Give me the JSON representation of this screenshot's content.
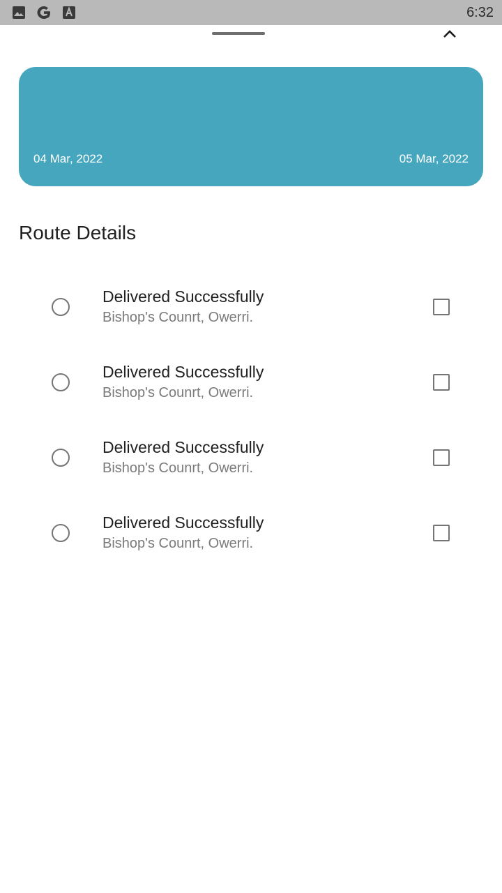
{
  "status_bar": {
    "time": "6:32",
    "icons": [
      "gallery-icon",
      "google-icon",
      "font-icon"
    ]
  },
  "sheet": {
    "handle": "drag-handle",
    "collapse_icon": "chevron-up-icon"
  },
  "trip_card": {
    "color": "#45a6be",
    "start_date": "04 Mar, 2022",
    "end_date": "05 Mar, 2022"
  },
  "route_details": {
    "title": "Route Details",
    "items": [
      {
        "status": "Delivered Successfully",
        "address": "Bishop's Counrt, Owerri.",
        "selected": false,
        "checked": false
      },
      {
        "status": "Delivered Successfully",
        "address": "Bishop's Counrt, Owerri.",
        "selected": false,
        "checked": false
      },
      {
        "status": "Delivered Successfully",
        "address": "Bishop's Counrt, Owerri.",
        "selected": false,
        "checked": false
      },
      {
        "status": "Delivered Successfully",
        "address": "Bishop's Counrt, Owerri.",
        "selected": false,
        "checked": false
      }
    ]
  }
}
